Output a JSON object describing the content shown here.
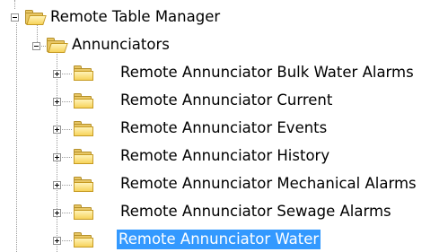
{
  "tree": {
    "root": {
      "label": "Remote Table Manager",
      "icon": "folder-icon",
      "expanded": true,
      "children": [
        {
          "label": "Annunciators",
          "icon": "folder-icon",
          "expanded": true,
          "children": [
            {
              "label": "Remote Annunciator Bulk Water Alarms",
              "expanded": false
            },
            {
              "label": "Remote Annunciator Current",
              "expanded": false
            },
            {
              "label": "Remote Annunciator Events",
              "expanded": false
            },
            {
              "label": "Remote Annunciator History",
              "expanded": false
            },
            {
              "label": "Remote Annunciator Mechanical Alarms",
              "expanded": false
            },
            {
              "label": "Remote Annunciator Sewage Alarms",
              "expanded": false
            },
            {
              "label": "Remote Annunciator Water",
              "expanded": false,
              "selected": true
            }
          ]
        }
      ]
    }
  },
  "colors": {
    "selection": "#3399ff",
    "folder": "#f7d35a"
  }
}
